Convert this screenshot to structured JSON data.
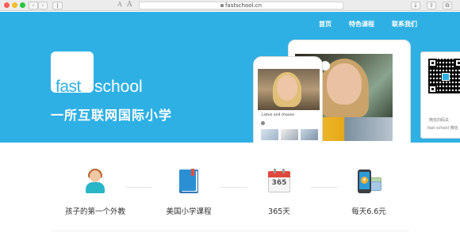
{
  "browser": {
    "url": "fastschool.cn",
    "reader_small": "A",
    "reader_big": "A"
  },
  "nav": {
    "items": [
      "首页",
      "特色课程",
      "联系我们"
    ]
  },
  "brand": {
    "logo_fast": "fast",
    "logo_school": "school",
    "slogan": "一所互联网国际小学"
  },
  "devices": {
    "phone_caption": "Listen and choose."
  },
  "qr": {
    "line1": "微信扫码关",
    "line2": "fast school 微信"
  },
  "features": [
    {
      "label": "孩子的第一个外教",
      "icon": "teacher-icon"
    },
    {
      "label": "美国小学课程",
      "icon": "book-icon"
    },
    {
      "label": "365天",
      "icon": "calendar-icon"
    },
    {
      "label": "每天6.6元",
      "icon": "phone-payment-icon"
    }
  ],
  "calendar_number": "365",
  "colors": {
    "hero_blue": "#2fb0e4",
    "white": "#ffffff"
  }
}
